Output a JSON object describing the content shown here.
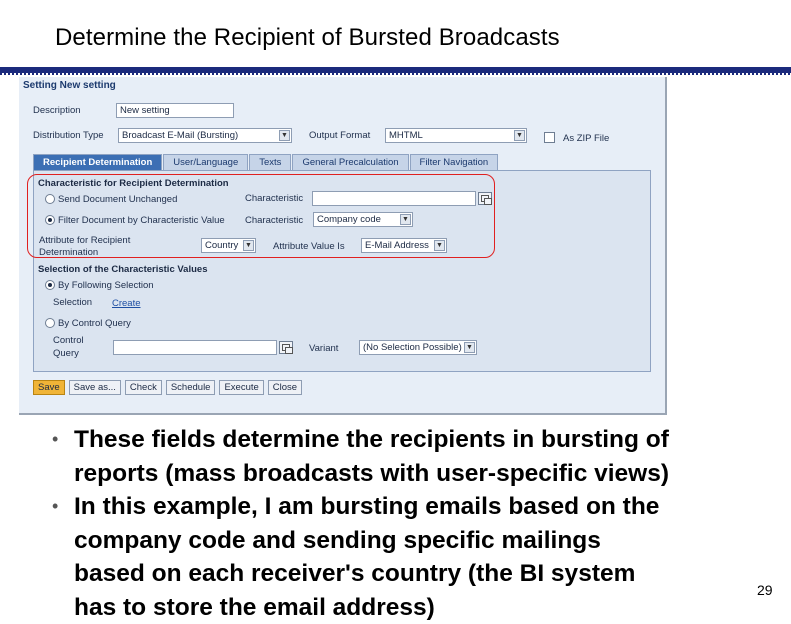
{
  "slide": {
    "title": "Determine the Recipient of Bursted Broadcasts",
    "page_number": "29"
  },
  "screenshot": {
    "window_title": "Setting New setting",
    "description": {
      "label": "Description",
      "value": "New setting"
    },
    "distribution_type": {
      "label": "Distribution Type",
      "value": "Broadcast E-Mail (Bursting)"
    },
    "output_format": {
      "label": "Output Format",
      "value": "MHTML"
    },
    "zip_file": {
      "label": "As ZIP File",
      "checked": false
    },
    "tabs": [
      {
        "label": "Recipient Determination",
        "active": true
      },
      {
        "label": "User/Language",
        "active": false
      },
      {
        "label": "Texts",
        "active": false
      },
      {
        "label": "General Precalculation",
        "active": false
      },
      {
        "label": "Filter Navigation",
        "active": false
      }
    ],
    "characteristic_section": {
      "title": "Characteristic for Recipient Determination",
      "option_unchanged": "Send Document Unchanged",
      "option_filter": "Filter Document by Characteristic Value",
      "characteristic_label": "Characteristic",
      "characteristic_value_top": "",
      "characteristic_value": "Company code",
      "attribute_label_line1": "Attribute for Recipient",
      "attribute_label_line2": "Determination",
      "attribute_value": "Country",
      "attribute_value_is_label": "Attribute Value Is",
      "attribute_value_is": "E-Mail Address"
    },
    "selection_section": {
      "title": "Selection of the Characteristic Values",
      "option_following": "By Following Selection",
      "selection_label": "Selection",
      "create_link": "Create",
      "option_query": "By Control Query",
      "control_query_label_line1": "Control",
      "control_query_label_line2": "Query",
      "control_query_value": "",
      "variant_label": "Variant",
      "variant_value": "(No Selection Possible)"
    },
    "buttons": [
      "Save",
      "Save as...",
      "Check",
      "Schedule",
      "Execute",
      "Close"
    ]
  },
  "bullets": {
    "b1_line1": "These fields determine the recipients in bursting of",
    "b1_line2": "reports (mass broadcasts with user-specific views)",
    "b2_line1": "In this example, I am bursting emails based on the",
    "b2_line2": "company code and sending specific mailings",
    "b2_line3": "based on each receiver's country (the BI system",
    "b2_line4": "has to store the email address)"
  },
  "colors": {
    "title_rule": "#1b2a7c",
    "highlight": "#e02020",
    "active_tab": "#3c6fb4",
    "primary_button": "#f0b437"
  }
}
